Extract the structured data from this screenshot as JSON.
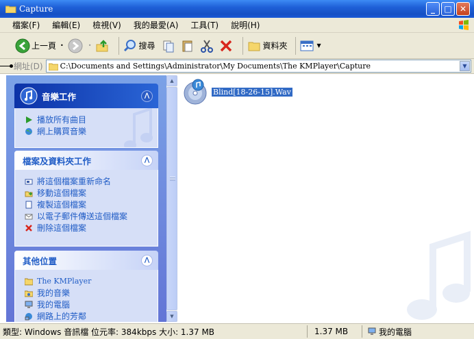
{
  "window": {
    "title": "Capture"
  },
  "menu": [
    "檔案(F)",
    "編輯(E)",
    "檢視(V)",
    "我的最愛(A)",
    "工具(T)",
    "說明(H)"
  ],
  "toolbar": {
    "back_label": "上一頁",
    "search_label": "搜尋",
    "folders_label": "資料夾"
  },
  "address": {
    "label": "網址(D)",
    "value": "C:\\Documents and Settings\\Administrator\\My Documents\\The KMPlayer\\Capture"
  },
  "sidebar": {
    "music_tasks": {
      "title": "音樂工作",
      "items": [
        {
          "label": "播放所有曲目",
          "icon": "play-icon"
        },
        {
          "label": "網上購買音樂",
          "icon": "globe-icon"
        }
      ]
    },
    "file_tasks": {
      "title": "檔案及資料夾工作",
      "items": [
        {
          "label": "將這個檔案重新命名",
          "icon": "rename-icon"
        },
        {
          "label": "移動這個檔案",
          "icon": "move-icon"
        },
        {
          "label": "複製這個檔案",
          "icon": "copy-icon"
        },
        {
          "label": "以電子郵件傳送這個檔案",
          "icon": "email-icon"
        },
        {
          "label": "刪除這個檔案",
          "icon": "delete-icon"
        }
      ]
    },
    "other_places": {
      "title": "其他位置",
      "items": [
        {
          "label": "The KMPlayer",
          "icon": "folder-icon"
        },
        {
          "label": "我的音樂",
          "icon": "my-music-icon"
        },
        {
          "label": "我的電腦",
          "icon": "my-computer-icon"
        },
        {
          "label": "網路上的芳鄰",
          "icon": "network-icon"
        }
      ]
    }
  },
  "files": [
    {
      "name": "Blind[18-26-15].Wav",
      "icon": "audio-file-icon",
      "selected": true
    }
  ],
  "status": {
    "description": "類型: Windows 音訊檔 位元率: 384kbps 大小: 1.37 MB",
    "size": "1.37 MB",
    "zone": "我的電腦"
  },
  "colors": {
    "titlebar": "#1f60d8",
    "taskpane": "#6f8ee0",
    "selection": "#316ac5",
    "link": "#215dc6"
  }
}
